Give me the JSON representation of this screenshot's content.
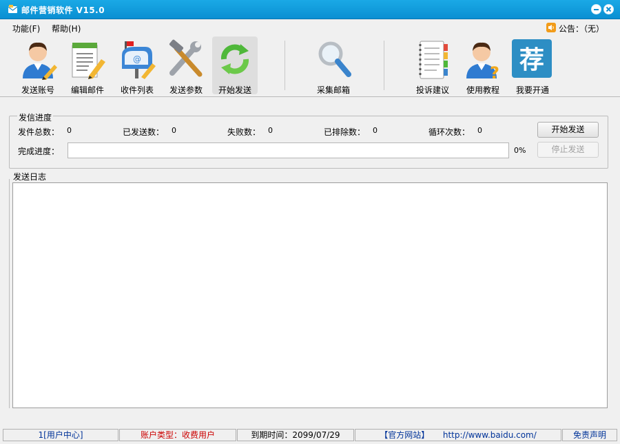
{
  "window": {
    "title": "邮件营销软件    V15.0"
  },
  "menu": {
    "items": [
      "功能(F)",
      "帮助(H)"
    ],
    "announcement": "公告：（无）"
  },
  "toolbar": {
    "tools": [
      {
        "label": "发送账号",
        "icon": "user-pencil-icon"
      },
      {
        "label": "编辑邮件",
        "icon": "notepad-pencil-icon"
      },
      {
        "label": "收件列表",
        "icon": "mailbox-icon"
      },
      {
        "label": "发送参数",
        "icon": "wrench-hammer-icon"
      },
      {
        "label": "开始发送",
        "icon": "refresh-arrows-icon"
      },
      {
        "label": "采集邮箱",
        "icon": "magnifier-icon"
      },
      {
        "label": "投诉建议",
        "icon": "notebook-icon"
      },
      {
        "label": "使用教程",
        "icon": "user-question-icon"
      },
      {
        "label": "我要开通",
        "icon": "recommend-icon",
        "glyph": "荐"
      }
    ]
  },
  "progress": {
    "group_title": "发信进度",
    "stats": [
      {
        "label": "发件总数：",
        "value": "0"
      },
      {
        "label": "已发送数：",
        "value": "0"
      },
      {
        "label": "失败数：",
        "value": "0"
      },
      {
        "label": "已排除数：",
        "value": "0"
      },
      {
        "label": "循环次数：",
        "value": "0"
      }
    ],
    "complete_label": "完成进度：",
    "percent": "0%",
    "percent_value": 0,
    "start_button": "开始发送",
    "stop_button": "停止发送"
  },
  "log": {
    "title": "发送日志"
  },
  "status": {
    "user_center": "1[用户中心]",
    "account_type": "账户类型：收费用户",
    "expire": "到期时间：2099/07/29",
    "site": "【官方网站】",
    "url": "http://www.baidu.com/",
    "disclaimer": "免责声明"
  },
  "colors": {
    "titlebar": "#1aa9e6",
    "account_type_text": "#cc0000",
    "link_text": "#003399"
  }
}
